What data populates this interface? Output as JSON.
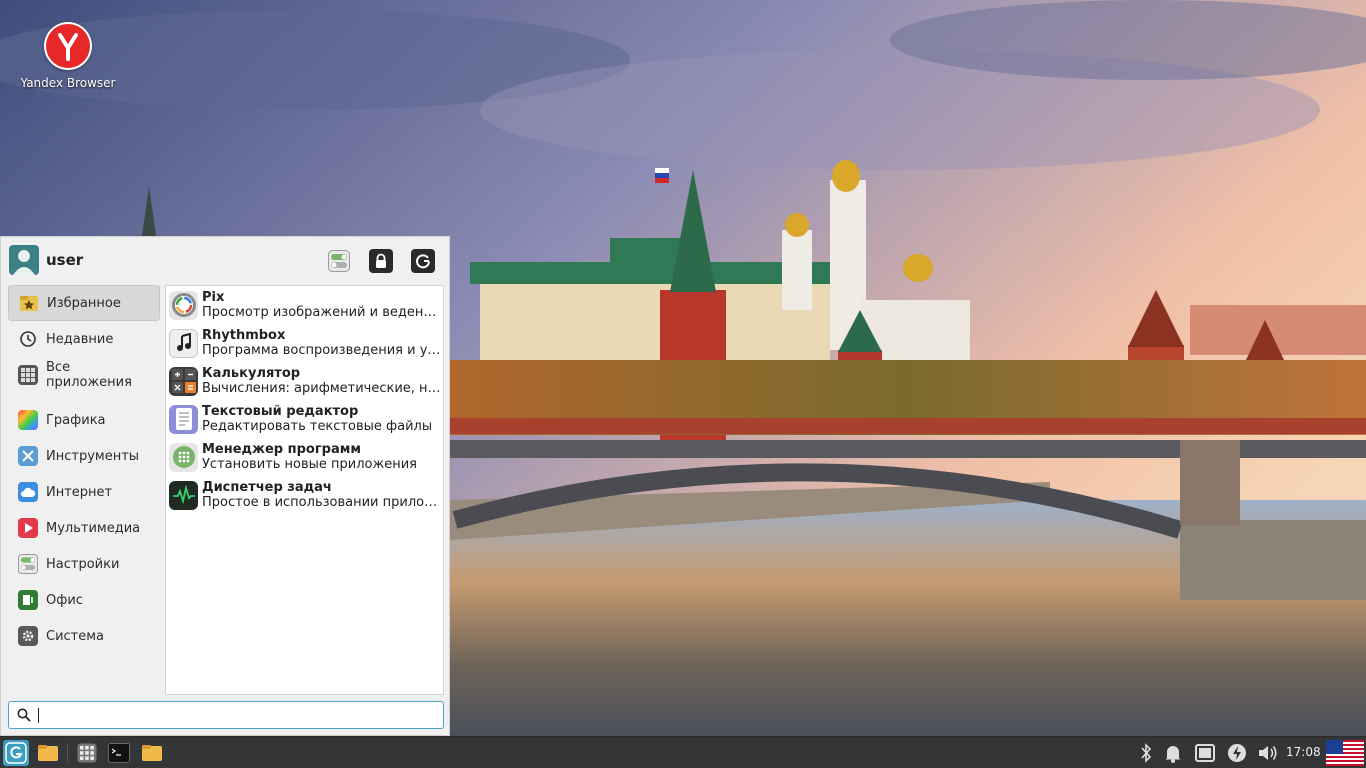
{
  "desktop": {
    "icons": [
      {
        "label": "Yandex Browser",
        "icon": "yandex-browser-icon",
        "accent": "#e62828"
      }
    ]
  },
  "menu": {
    "user": {
      "name": "user",
      "icon": "user-avatar-icon"
    },
    "header_buttons": [
      {
        "name": "settings-toggle-icon"
      },
      {
        "name": "lock-icon"
      },
      {
        "name": "logout-icon"
      }
    ],
    "categories": [
      {
        "label": "Избранное",
        "icon": "star-folder-icon",
        "active": true
      },
      {
        "label": "Недавние",
        "icon": "clock-icon"
      },
      {
        "label": "Все приложения",
        "icon": "grid-apps-icon"
      },
      {
        "label": "Графика",
        "icon": "graphics-icon"
      },
      {
        "label": "Инструменты",
        "icon": "tools-icon"
      },
      {
        "label": "Интернет",
        "icon": "cloud-icon"
      },
      {
        "label": "Мультимедиа",
        "icon": "play-icon"
      },
      {
        "label": "Настройки",
        "icon": "settings-toggle-icon"
      },
      {
        "label": "Офис",
        "icon": "office-icon"
      },
      {
        "label": "Система",
        "icon": "gear-icon"
      }
    ],
    "apps": [
      {
        "title": "Pix",
        "desc": "Просмотр изображений и ведение …",
        "icon": "pix-icon"
      },
      {
        "title": "Rhythmbox",
        "desc": "Программа воспроизведения и уп…",
        "icon": "music-note-icon"
      },
      {
        "title": "Калькулятор",
        "desc": "Вычисления: арифметические, нау…",
        "icon": "calculator-icon"
      },
      {
        "title": "Текстовый редактор",
        "desc": "Редактировать текстовые файлы",
        "icon": "text-editor-icon"
      },
      {
        "title": "Менеджер программ",
        "desc": "Установить новые приложения",
        "icon": "software-manager-icon"
      },
      {
        "title": "Диспетчер задач",
        "desc": "Простое в использовании приложе…",
        "icon": "task-manager-icon"
      }
    ],
    "search": {
      "value": "",
      "placeholder": ""
    }
  },
  "taskbar": {
    "left_items": [
      {
        "name": "menu-start-icon"
      },
      {
        "name": "show-desktop-icon"
      },
      {
        "name": "app-grid-icon"
      },
      {
        "name": "terminal-icon"
      },
      {
        "name": "file-manager-icon"
      }
    ],
    "tray": [
      {
        "name": "bluetooth-icon"
      },
      {
        "name": "notifications-bell-icon"
      },
      {
        "name": "window-list-icon"
      },
      {
        "name": "power-icon"
      },
      {
        "name": "volume-icon"
      }
    ],
    "clock": "17:08",
    "keyboard_layout_icon": "us-flag-icon"
  },
  "colors": {
    "accent": "#4aa5c4",
    "taskbar": "#333537",
    "menu_bg": "#f0f0f0"
  }
}
